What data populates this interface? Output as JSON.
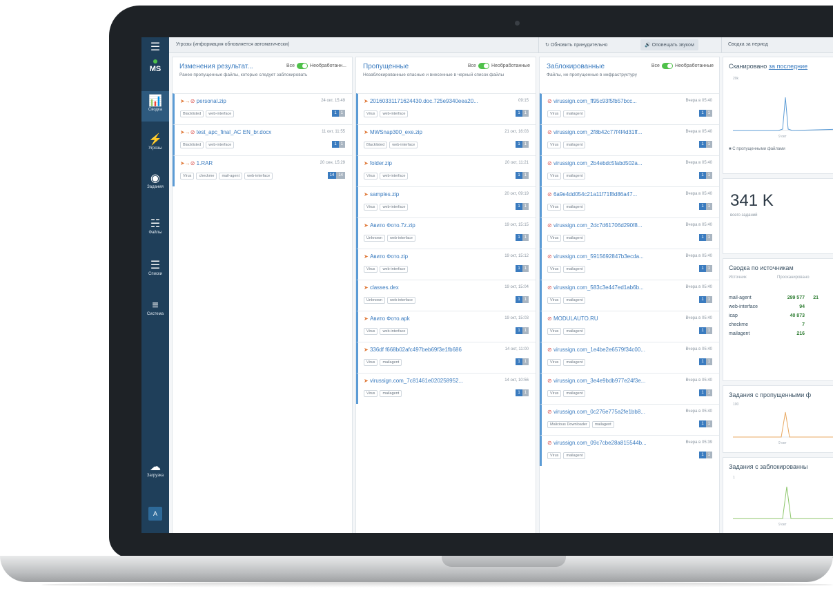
{
  "toolbar": {
    "title": "Угрозы (информация обновляется автоматически)",
    "refresh_label": "Обновить принудительно",
    "notify_label": "Оповещать звуком",
    "summary_label": "Сводка за период"
  },
  "sidebar": {
    "status": "MS",
    "items": [
      {
        "label": "Сводка",
        "icon": "bar-chart-icon"
      },
      {
        "label": "Угрозы",
        "icon": "lightning-icon"
      },
      {
        "label": "Задания",
        "icon": "globe-icon"
      },
      {
        "label": "Файлы",
        "icon": "database-icon"
      },
      {
        "label": "Списки",
        "icon": "list-icon"
      },
      {
        "label": "Система",
        "icon": "sliders-icon"
      }
    ],
    "upload_label": "Загрузка",
    "avatar_letter": "A"
  },
  "columns": [
    {
      "title": "Изменения результат...",
      "filter_all": "Все",
      "filter_unprocessed": "Необработанн...",
      "description": "Ранее пропущенные файлы, которые следует заблокировать",
      "cards": [
        {
          "name": "personal.zip",
          "time": "24 окт, 15:49",
          "tags": [
            "Blacklisted",
            "web-interface"
          ],
          "count_a": "1",
          "count_b": "1"
        },
        {
          "name": "test_apc_final_AC EN_br.docx",
          "time": "11 окт, 11:55",
          "tags": [
            "Blacklisted",
            "web-interface"
          ],
          "count_a": "1",
          "count_b": "1"
        },
        {
          "name": "1.RAR",
          "time": "20 сен, 15:29",
          "tags": [
            "Virus",
            "checkme",
            "mail-agent",
            "web-interface"
          ],
          "count_a": "14",
          "count_b": "14"
        }
      ]
    },
    {
      "title": "Пропущенные",
      "filter_all": "Все",
      "filter_unprocessed": "Необработанные",
      "description": "Незаблокированные опасные и внесенные в черный список файлы",
      "cards": [
        {
          "name": "20160331171624430.doc.725e9340eea20...",
          "time": "09:15",
          "tags": [
            "Virus",
            "web-interface"
          ],
          "count_a": "1",
          "count_b": "1"
        },
        {
          "name": "MWSnap300_exe.zip",
          "time": "21 окт, 16:03",
          "tags": [
            "Blacklisted",
            "web-interface"
          ],
          "count_a": "1",
          "count_b": "1"
        },
        {
          "name": "folder.zip",
          "time": "20 окт, 11:21",
          "tags": [
            "Virus",
            "web-interface"
          ],
          "count_a": "1",
          "count_b": "1"
        },
        {
          "name": "samples.zip",
          "time": "20 окт, 09:19",
          "tags": [
            "Virus",
            "web-interface"
          ],
          "count_a": "1",
          "count_b": "1"
        },
        {
          "name": "Авито Фото.7z.zip",
          "time": "19 окт, 15:15",
          "tags": [
            "Unknown",
            "web-interface"
          ],
          "count_a": "1",
          "count_b": "1"
        },
        {
          "name": "Авито Фото.zip",
          "time": "19 окт, 15:12",
          "tags": [
            "Virus",
            "web-interface"
          ],
          "count_a": "1",
          "count_b": "1"
        },
        {
          "name": "classes.dex",
          "time": "19 окт, 15:04",
          "tags": [
            "Unknown",
            "web-interface"
          ],
          "count_a": "1",
          "count_b": "1"
        },
        {
          "name": "Авито Фото.apk",
          "time": "19 окт, 15:03",
          "tags": [
            "Virus",
            "web-interface"
          ],
          "count_a": "1",
          "count_b": "1"
        },
        {
          "name": "336df f668b02afc497beb69f3e1fb686",
          "time": "14 окт, 11:00",
          "tags": [
            "Virus",
            "mailagent"
          ],
          "count_a": "1",
          "count_b": "1"
        },
        {
          "name": "virussign.com_7c81461e020258952...",
          "time": "14 окт, 10:56",
          "tags": [
            "Virus",
            "mailagent"
          ],
          "count_a": "1",
          "count_b": "1"
        }
      ]
    },
    {
      "title": "Заблокированные",
      "filter_all": "Все",
      "filter_unprocessed": "Необработанные",
      "description": "Файлы, не пропущенные в инфраструктуру",
      "cards": [
        {
          "name": "virussign.com_ff95c93f5fb57bcc...",
          "time": "Вчера в 05:40",
          "tags": [
            "Virus",
            "mailagent"
          ],
          "count_a": "1",
          "count_b": "1"
        },
        {
          "name": "virussign.com_2f8b42c77f4f4d31ff...",
          "time": "Вчера в 05:40",
          "tags": [
            "Virus",
            "mailagent"
          ],
          "count_a": "1",
          "count_b": "1"
        },
        {
          "name": "virussign.com_2b4ebdc5fabd502a...",
          "time": "Вчера в 05:40",
          "tags": [
            "Virus",
            "mailagent"
          ],
          "count_a": "1",
          "count_b": "1"
        },
        {
          "name": "6a9e4dd054c21a11f71f8d86a47...",
          "time": "Вчера в 05:40",
          "tags": [
            "Virus",
            "mailagent"
          ],
          "count_a": "1",
          "count_b": "1"
        },
        {
          "name": "virussign.com_2dc7d61706d290f8...",
          "time": "Вчера в 05:40",
          "tags": [
            "Virus",
            "mailagent"
          ],
          "count_a": "1",
          "count_b": "1"
        },
        {
          "name": "virussign.com_5915692847b3ecda...",
          "time": "Вчера в 05:40",
          "tags": [
            "Virus",
            "mailagent"
          ],
          "count_a": "1",
          "count_b": "1"
        },
        {
          "name": "virussign.com_583c3e447ed1ab6b...",
          "time": "Вчера в 05:40",
          "tags": [
            "Virus",
            "mailagent"
          ],
          "count_a": "1",
          "count_b": "1"
        },
        {
          "name": "MODULAUTO.RU",
          "time": "Вчера в 05:40",
          "tags": [
            "Virus",
            "mailagent"
          ],
          "count_a": "1",
          "count_b": "1"
        },
        {
          "name": "virussign.com_1e4be2e6579f34c00...",
          "time": "Вчера в 05:40",
          "tags": [
            "Virus",
            "mailagent"
          ],
          "count_a": "1",
          "count_b": "1"
        },
        {
          "name": "virussign.com_3e4e9bdb977e24f3e...",
          "time": "Вчера в 05:40",
          "tags": [
            "Virus",
            "mailagent"
          ],
          "count_a": "1",
          "count_b": "1"
        },
        {
          "name": "virussign.com_0c276e775a2fe1bb8...",
          "time": "Вчера в 05:40",
          "tags": [
            "Malicious Downloader",
            "mailagent"
          ],
          "count_a": "1",
          "count_b": "1"
        },
        {
          "name": "virussign.com_09c7cbe28a815544b...",
          "time": "Вчера в 05:39",
          "tags": [
            "Virus",
            "mailagent"
          ],
          "count_a": "1",
          "count_b": "1"
        }
      ]
    }
  ],
  "summary": {
    "scanned_title": "Сканировано",
    "scanned_link": "за последние",
    "chart_y_label": "20k",
    "chart_x_label": "9 окт",
    "legend": "С пропущенными файлами",
    "total_value": "341 K",
    "total_label": "всего заданий",
    "sources_title": "Сводка по источникам",
    "sources_col1": "Источник",
    "sources_col2": "Просканировано",
    "sources": [
      {
        "name": "mail-agent",
        "value": "299 577",
        "extra": "21"
      },
      {
        "name": "web-interface",
        "value": "94",
        "extra": ""
      },
      {
        "name": "icap",
        "value": "40 873",
        "extra": ""
      },
      {
        "name": "checkme",
        "value": "7",
        "extra": ""
      },
      {
        "name": "mailagent",
        "value": "216",
        "extra": ""
      }
    ],
    "missed_title": "Задания с пропущенными ф",
    "missed_y": "100",
    "missed_x": "9 окт",
    "blocked_title": "Задания с заблокированны",
    "blocked_y": "1",
    "blocked_x": "9 окт"
  },
  "colors": {
    "accent": "#3a7bbf",
    "sidebar": "#1f3f5a",
    "green": "#4fc14a"
  }
}
